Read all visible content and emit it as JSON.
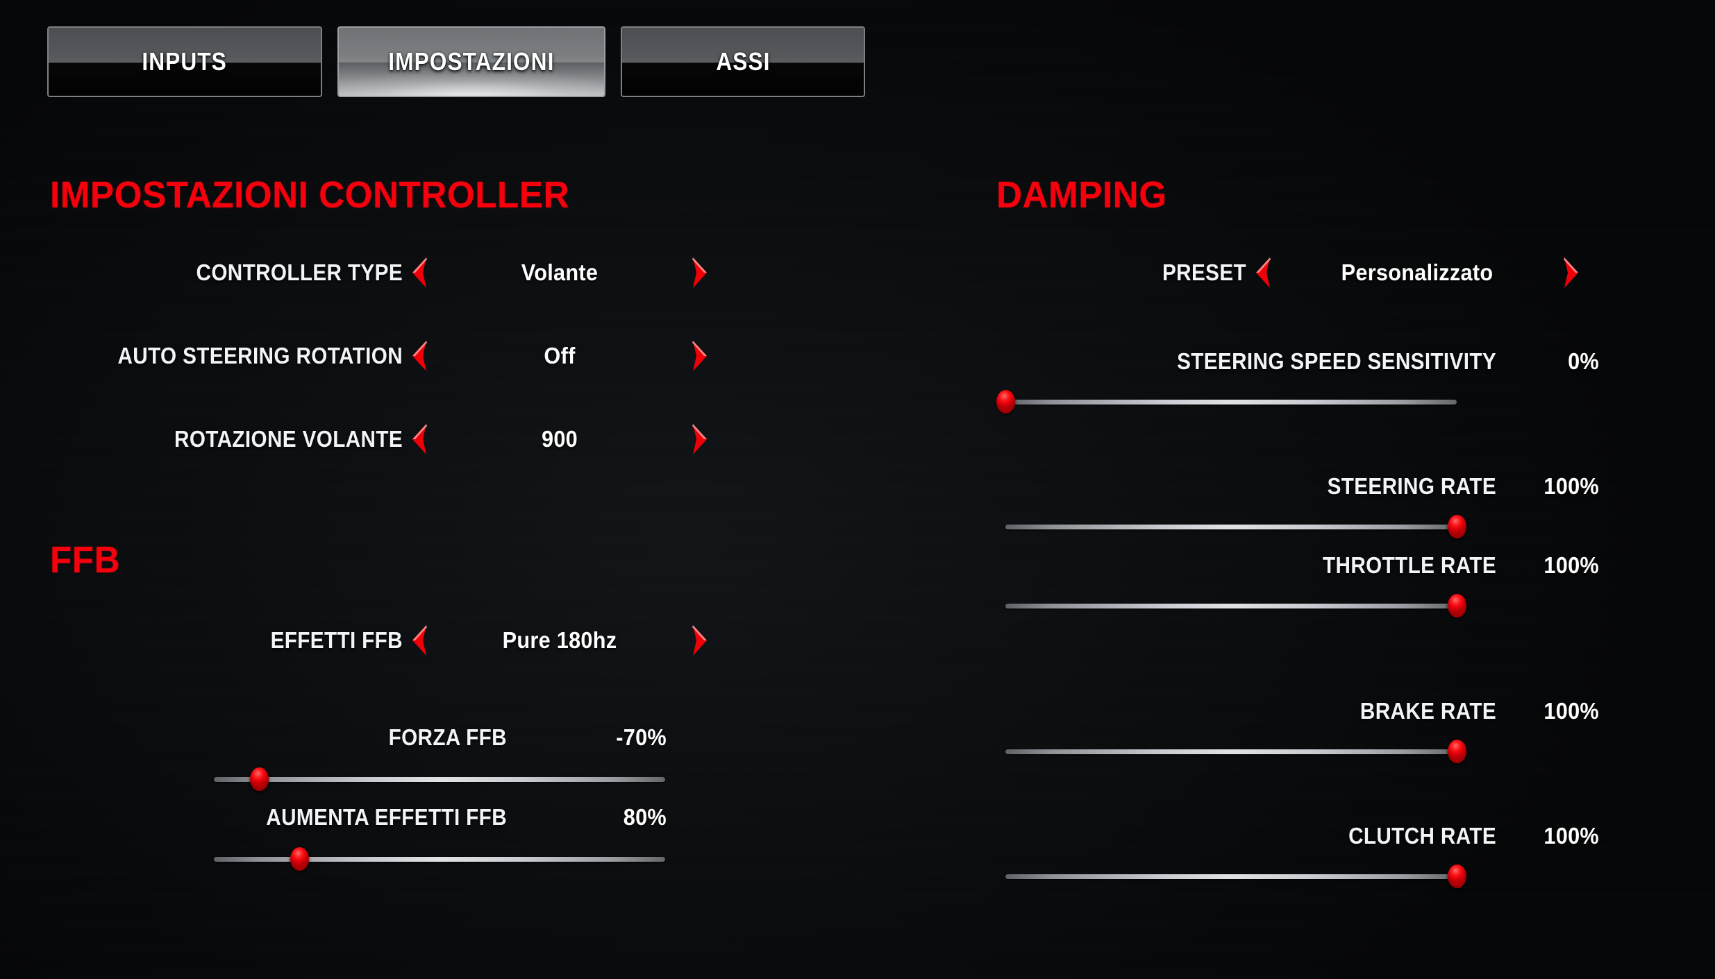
{
  "tabs": [
    {
      "label": "INPUTS",
      "active": false
    },
    {
      "label": "IMPOSTAZIONI",
      "active": true
    },
    {
      "label": "ASSI",
      "active": false
    }
  ],
  "colors": {
    "accent_red": "#f5000c",
    "knob_red": "#fb1417",
    "text_white": "#f3f4f5"
  },
  "left_column": {
    "controller_section": {
      "title": "IMPOSTAZIONI CONTROLLER",
      "rows": [
        {
          "label": "CONTROLLER TYPE",
          "value": "Volante"
        },
        {
          "label": "AUTO STEERING ROTATION",
          "value": "Off"
        },
        {
          "label": "ROTAZIONE VOLANTE",
          "value": "900"
        }
      ]
    },
    "ffb_section": {
      "title": "FFB",
      "selector_rows": [
        {
          "label": "EFFETTI FFB",
          "value": "Pure 180hz"
        }
      ],
      "slider_rows": [
        {
          "label": "FORZA FFB",
          "value": "-70%",
          "fill": 10
        },
        {
          "label": "AUMENTA EFFETTI FFB",
          "value": "80%",
          "fill": 19
        }
      ]
    }
  },
  "right_column": {
    "damping_section": {
      "title": "DAMPING",
      "selector_rows": [
        {
          "label": "PRESET",
          "value": "Personalizzato"
        }
      ],
      "slider_rows": [
        {
          "label": "STEERING SPEED SENSITIVITY",
          "value": "0%",
          "fill": 0
        },
        {
          "label": "STEERING RATE",
          "value": "100%",
          "fill": 100
        },
        {
          "label": "THROTTLE RATE",
          "value": "100%",
          "fill": 100
        },
        {
          "label": "BRAKE RATE",
          "value": "100%",
          "fill": 100
        },
        {
          "label": "CLUTCH RATE",
          "value": "100%",
          "fill": 100
        }
      ]
    }
  },
  "icons": {
    "prev": "chevron-left-icon",
    "next": "chevron-right-icon"
  }
}
